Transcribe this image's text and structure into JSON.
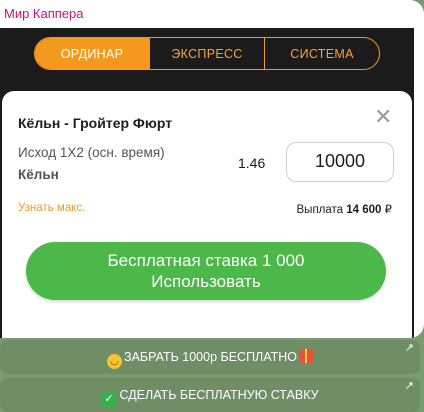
{
  "channel": {
    "name": "Мир Каппера"
  },
  "tabs": [
    {
      "label": "ОРДИНАР",
      "active": true
    },
    {
      "label": "ЭКСПРЕСС",
      "active": false
    },
    {
      "label": "СИСТЕМА",
      "active": false
    }
  ],
  "bet_slip": {
    "match": "Кёльн - Гройтер Фюрт",
    "outcome": "Исход 1Х2 (осн. время)",
    "selection": "Кёльн",
    "odds": "1.46",
    "stake": "10000",
    "max_link": "Узнать макс.",
    "payout_label": "Выплата",
    "payout_value": "14 600",
    "currency": "₽",
    "close_icon": "close-icon",
    "button_line1": "Бесплатная ставка 1 000",
    "button_line2": "Использовать"
  },
  "inline_buttons": [
    {
      "label": "ЗАБРАТЬ 1000р БЕСПЛАТНО",
      "icon": "grinning-face-icon",
      "icon2": "gift-icon"
    },
    {
      "label": "СДЕЛАТЬ БЕСПЛАТНУЮ СТАВКУ",
      "icon": "check-mark-icon"
    }
  ],
  "colors": {
    "accent": "#f39a1e",
    "channel_name": "#c6127e",
    "button_green": "#4cb849",
    "dark_bg": "#1b1b1b"
  }
}
